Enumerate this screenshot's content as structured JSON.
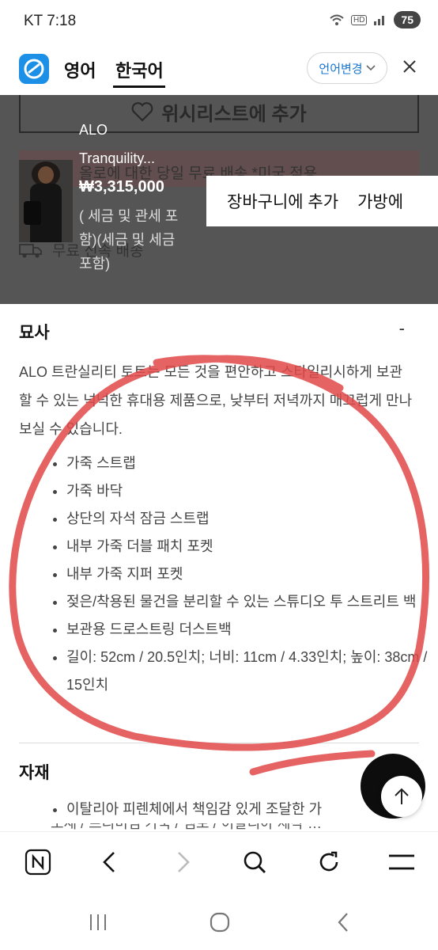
{
  "status_bar": {
    "carrier_time": "KT 7:18",
    "hd_label": "HD",
    "battery": "75"
  },
  "translate_bar": {
    "lang_source": "영어",
    "lang_target": "한국어",
    "lang_change": "언어변경",
    "app_icon": "translate-app-icon",
    "accent_color": "#1976d2"
  },
  "product": {
    "wishlist_button": "위시리스트에 추가",
    "shipping_note": "올로에 대한 당일 무료 배송 *미국 적용",
    "free_shipping": "무료 신속 배송",
    "brand": "ALO",
    "name": "Tranquility...",
    "price": "₩3,315,000",
    "tax_note": "( 세금 및 관세 포함)(세금 및 세금 포함)",
    "add_to_cart": "장바구니에 추가",
    "add_to_bag": "가방에"
  },
  "description": {
    "title": "묘사",
    "collapse": "-",
    "text": "ALO 트란실리티 토트는 모든 것을 편안하고 스타일리시하게 보관할 수 있는 넉넉한 휴대용 제품으로, 낮부터 저녁까지 매끄럽게 만나보실 수 있습니다.",
    "bullets": [
      "가죽 스트랩",
      "가죽 바닥",
      "상단의 자석 잠금 스트랩",
      "내부 가죽 더블 패치 포켓",
      "내부 가죽 지퍼 포켓",
      "젖은/착용된 물건을 분리할 수 있는 스튜디오 투 스트리트 백",
      "보관용 드로스트링 더스트백",
      "길이: 52cm / 20.5인치; 너비: 11cm / 4.33인치; 높이: 38cm / 15인치"
    ]
  },
  "material": {
    "title": "자재",
    "bullets": [
      "이탈리아 피렌체에서 책임감 있게 조달한 가"
    ],
    "cut_off_line": "소재 / 프리미엄 가죽 / 엠보 / 이탈리아 제작 …"
  },
  "annotation_color": "#e04848",
  "browser_toolbar": {
    "icons": [
      "naver-icon",
      "back-icon",
      "forward-icon",
      "search-icon",
      "refresh-icon",
      "menu-icon"
    ]
  },
  "android_nav": {
    "icons": [
      "recents-icon",
      "home-icon",
      "back-nav-icon"
    ]
  }
}
